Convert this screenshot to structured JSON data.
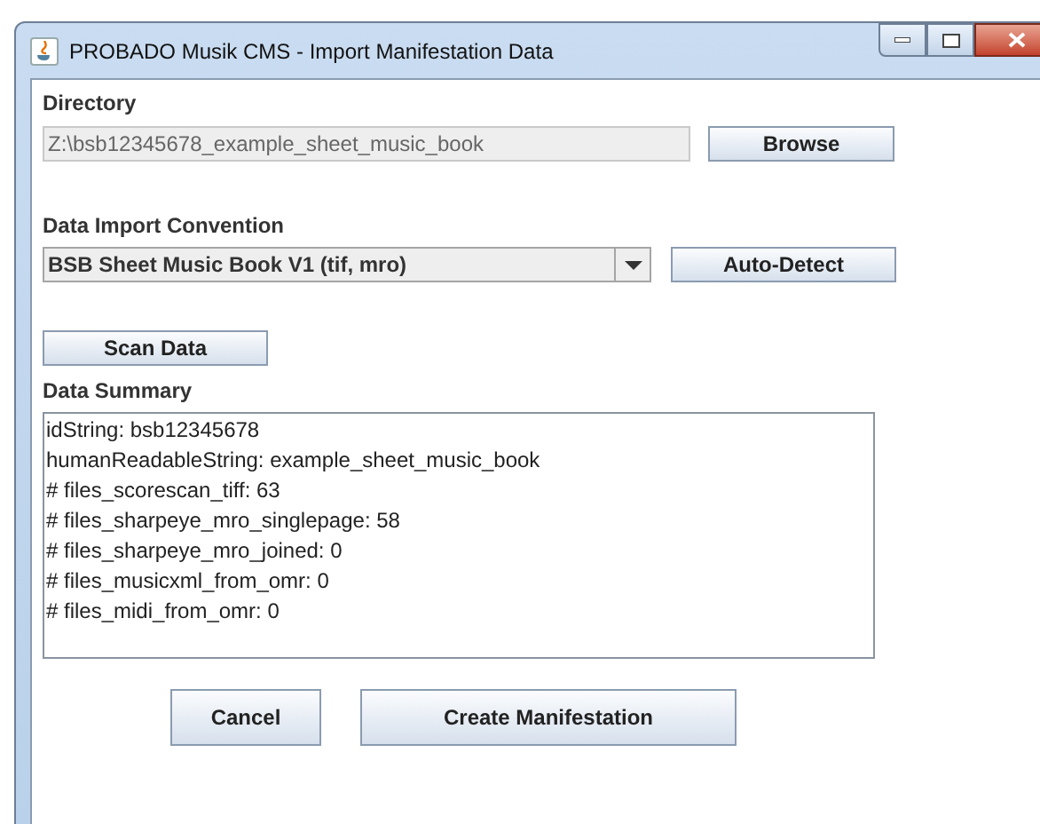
{
  "window": {
    "title": "PROBADO Musik CMS - Import Manifestation Data"
  },
  "directory": {
    "label": "Directory",
    "value": "Z:\\bsb12345678_example_sheet_music_book",
    "button": "Browse"
  },
  "convention": {
    "label": "Data Import Convention",
    "value": "BSB Sheet Music Book V1 (tif, mro)",
    "button": "Auto-Detect"
  },
  "scan_button": "Scan Data",
  "summary": {
    "label": "Data Summary",
    "lines": [
      "idString: bsb12345678",
      "humanReadableString: example_sheet_music_book",
      "# files_scorescan_tiff: 63",
      "# files_sharpeye_mro_singlepage: 58",
      "# files_sharpeye_mro_joined: 0",
      "# files_musicxml_from_omr: 0",
      "# files_midi_from_omr: 0"
    ]
  },
  "buttons": [
    "Cancel",
    "Create Manifestation"
  ]
}
